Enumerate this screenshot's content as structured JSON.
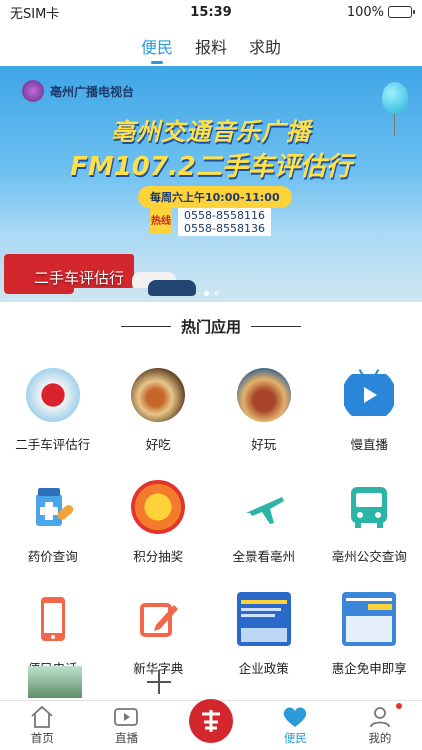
{
  "status": {
    "carrier": "无SIM卡",
    "time": "15:39",
    "battery": "100%"
  },
  "topnav": {
    "tabs": [
      {
        "label": "便民",
        "active": true
      },
      {
        "label": "报料",
        "active": false
      },
      {
        "label": "求助",
        "active": false
      }
    ]
  },
  "banner": {
    "logo_name": "亳州广播电视台",
    "line1": "亳州交通音乐广播",
    "line2": "FM107.2二手车评估行",
    "time": "每周六上午10:00-11:00",
    "hotline_tag": "热线",
    "phone1": "0558-8558116",
    "phone2": "0558-8558136",
    "caption": "二手车评估行"
  },
  "section": {
    "title": "热门应用"
  },
  "apps": [
    {
      "label": "二手车评估行",
      "icon": "used-car-photo"
    },
    {
      "label": "好吃",
      "icon": "food-photo"
    },
    {
      "label": "好玩",
      "icon": "attraction-photo"
    },
    {
      "label": "慢直播",
      "icon": "tv-icon"
    },
    {
      "label": "药价查询",
      "icon": "medicine-icon"
    },
    {
      "label": "积分抽奖",
      "icon": "lottery-wheel-icon"
    },
    {
      "label": "全景看亳州",
      "icon": "plane-icon"
    },
    {
      "label": "亳州公交查询",
      "icon": "bus-icon"
    },
    {
      "label": "便民电话",
      "icon": "phone-icon"
    },
    {
      "label": "新华字典",
      "icon": "edit-icon"
    },
    {
      "label": "企业政策",
      "icon": "policy-thumbnail"
    },
    {
      "label": "惠企免申即享",
      "icon": "benefit-thumbnail"
    }
  ],
  "bottom": {
    "items": [
      {
        "label": "首页",
        "icon": "home-icon"
      },
      {
        "label": "直播",
        "icon": "live-video-icon"
      },
      {
        "label": "",
        "icon": "station-logo"
      },
      {
        "label": "便民",
        "icon": "heart-icon"
      },
      {
        "label": "我的",
        "icon": "profile-icon"
      }
    ]
  },
  "colors": {
    "accent": "#2a9bd8",
    "brand_red": "#d4262d"
  }
}
